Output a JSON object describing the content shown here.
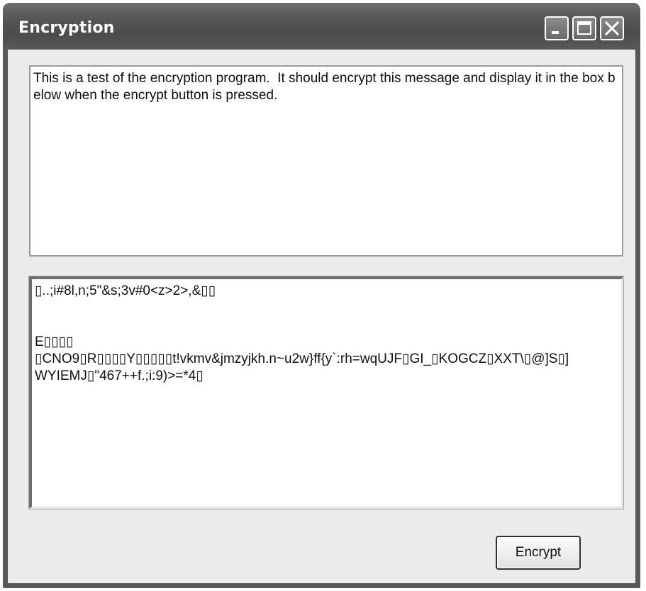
{
  "window": {
    "title": "Encryption"
  },
  "title_controls": {
    "minimize_icon": "minimize-icon",
    "maximize_icon": "maximize-icon",
    "close_icon": "close-icon"
  },
  "input_box": {
    "value": "This is a test of the encryption program.  It should encrypt this message and display it in the box below when the encrypt button is pressed."
  },
  "output_box": {
    "value": "▯..;i#8l,n;5\"&s;3v#0<z>2>,&▯▯\n\n\nE▯▯▯▯\n▯CNO9▯R▯▯▯▯Y▯▯▯▯▯t!vkmv&jmzyjkh.n~u2w}ff{y`:rh=wqUJF▯GI_▯KOGCZ▯XXT\\▯@]S▯]\nWYIEMJ▯\"467++f.;i:9)>=*4▯"
  },
  "buttons": {
    "encrypt_label": "Encrypt"
  },
  "colors": {
    "title_bar": "#555555",
    "client_background": "#ececec",
    "text_box_background": "#ffffff"
  }
}
